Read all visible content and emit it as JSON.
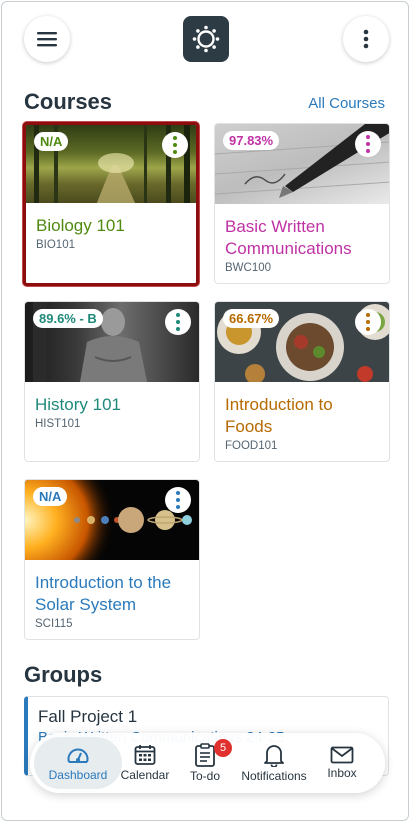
{
  "header": {
    "menu_icon": "hamburger-icon",
    "logo_icon": "canvas-logo-icon",
    "more_icon": "vertical-ellipsis-icon"
  },
  "courses": {
    "title": "Courses",
    "all_link": "All Courses",
    "items": [
      {
        "grade": "N/A",
        "name": "Biology 101",
        "code": "BIO101",
        "color": "#4f8a10",
        "image": "forest path"
      },
      {
        "grade": "97.83%",
        "name": "Basic Written Communications",
        "code": "BWC100",
        "color": "#bf32a4",
        "image": "fountain pen on paper"
      },
      {
        "grade": "89.6% - B",
        "name": "History 101",
        "code": "HIST101",
        "color": "#1f8a7a",
        "image": "Lincoln memorial statue"
      },
      {
        "grade": "66.67%",
        "name": "Introduction to Foods",
        "code": "FOOD101",
        "color": "#b66a00",
        "image": "plates of food"
      },
      {
        "grade": "N/A",
        "name": "Introduction to the Solar System",
        "code": "SCI115",
        "color": "#2b7abc",
        "image": "sun and planets"
      }
    ]
  },
  "groups": {
    "title": "Groups",
    "items": [
      {
        "name": "Fall Project 1",
        "course": "Basic Written Communications 24-25"
      }
    ]
  },
  "tabbar": {
    "items": [
      {
        "label": "Dashboard",
        "icon": "dashboard-icon",
        "active": true
      },
      {
        "label": "Calendar",
        "icon": "calendar-icon"
      },
      {
        "label": "To-do",
        "icon": "todo-clipboard-icon",
        "badge": "5"
      },
      {
        "label": "Notifications",
        "icon": "bell-icon"
      },
      {
        "label": "Inbox",
        "icon": "envelope-icon"
      }
    ]
  }
}
